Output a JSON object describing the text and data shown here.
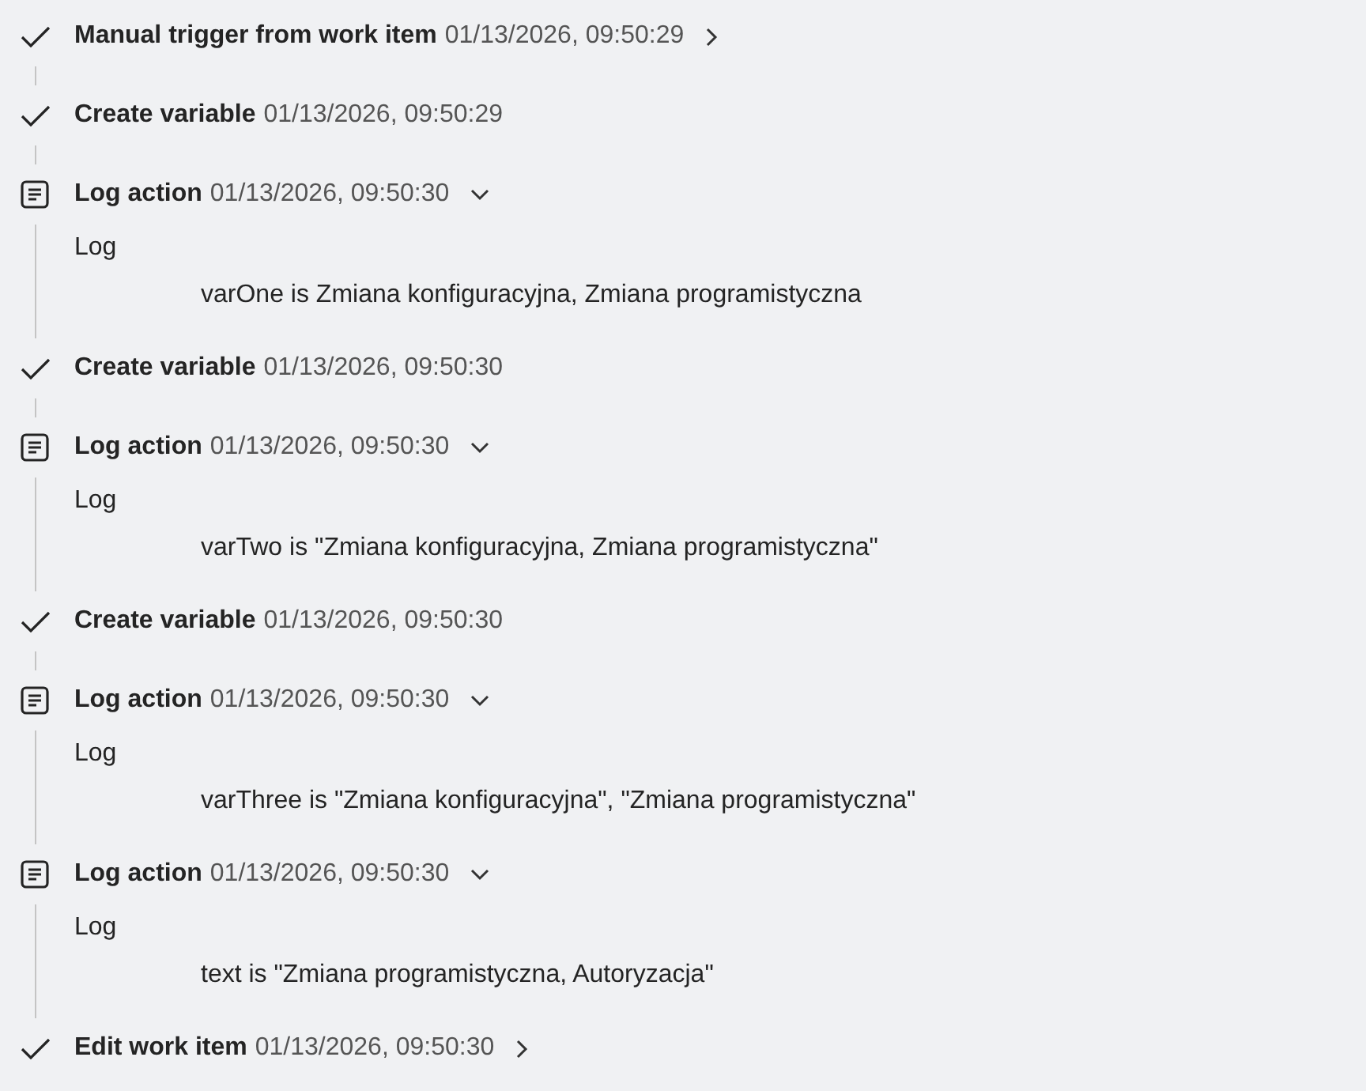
{
  "steps": [
    {
      "kind": "check",
      "title": "Manual trigger from work item",
      "time": "01/13/2026, 09:50:29",
      "expandable": true,
      "expanded": false
    },
    {
      "kind": "check",
      "title": "Create variable",
      "time": "01/13/2026, 09:50:29",
      "expandable": false,
      "expanded": false
    },
    {
      "kind": "log",
      "title": "Log action",
      "time": "01/13/2026, 09:50:30",
      "expandable": true,
      "expanded": true,
      "detail_label": "Log",
      "message": "varOne is Zmiana konfiguracyjna, Zmiana programistyczna"
    },
    {
      "kind": "check",
      "title": "Create variable",
      "time": "01/13/2026, 09:50:30",
      "expandable": false,
      "expanded": false
    },
    {
      "kind": "log",
      "title": "Log action",
      "time": "01/13/2026, 09:50:30",
      "expandable": true,
      "expanded": true,
      "detail_label": "Log",
      "message": "varTwo is \"Zmiana konfiguracyjna, Zmiana programistyczna\""
    },
    {
      "kind": "check",
      "title": "Create variable",
      "time": "01/13/2026, 09:50:30",
      "expandable": false,
      "expanded": false
    },
    {
      "kind": "log",
      "title": "Log action",
      "time": "01/13/2026, 09:50:30",
      "expandable": true,
      "expanded": true,
      "detail_label": "Log",
      "message": "varThree is \"Zmiana konfiguracyjna\", \"Zmiana programistyczna\""
    },
    {
      "kind": "log",
      "title": "Log action",
      "time": "01/13/2026, 09:50:30",
      "expandable": true,
      "expanded": true,
      "detail_label": "Log",
      "message": "text is \"Zmiana programistyczna, Autoryzacja\""
    },
    {
      "kind": "check",
      "title": "Edit work item",
      "time": "01/13/2026, 09:50:30",
      "expandable": true,
      "expanded": false
    }
  ]
}
